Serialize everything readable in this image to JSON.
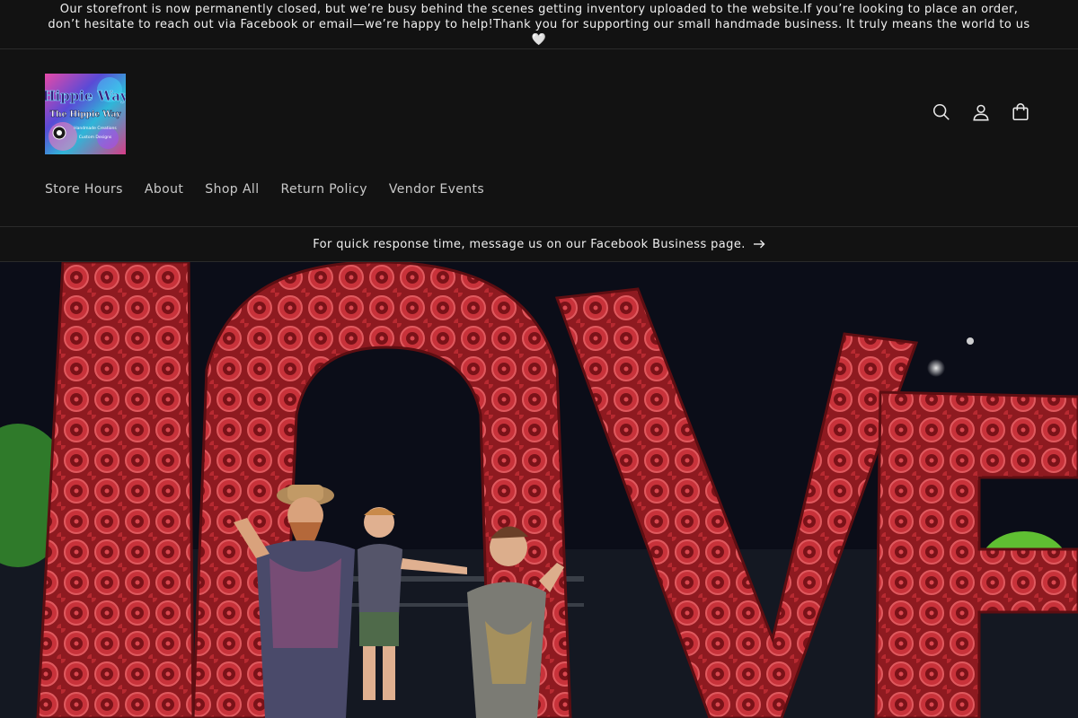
{
  "announcement": {
    "text": "Our storefront is now permanently closed, but we’re busy behind the scenes getting inventory uploaded to the website.If you’re looking to place an order, don’t hesitate to reach out via Facebook or email—we’re happy to help!Thank you for supporting our small handmade business. It truly means the world to us 🤍"
  },
  "header": {
    "logo": {
      "line1": "Hippie Way",
      "line2": "The Hippie Way",
      "line3": "Handmade Creations",
      "line4": "Custom Designs"
    },
    "icons": [
      "search-icon",
      "account-icon",
      "cart-icon"
    ]
  },
  "nav": {
    "items": [
      {
        "label": "Store Hours"
      },
      {
        "label": "About"
      },
      {
        "label": "Shop All"
      },
      {
        "label": "Return Policy"
      },
      {
        "label": "Vendor Events"
      }
    ]
  },
  "notice": {
    "text": "For quick response time, message us on our Facebook Business page."
  },
  "hero": {
    "sign_color": "#b8232a",
    "sky_color": "#0b0d18"
  }
}
